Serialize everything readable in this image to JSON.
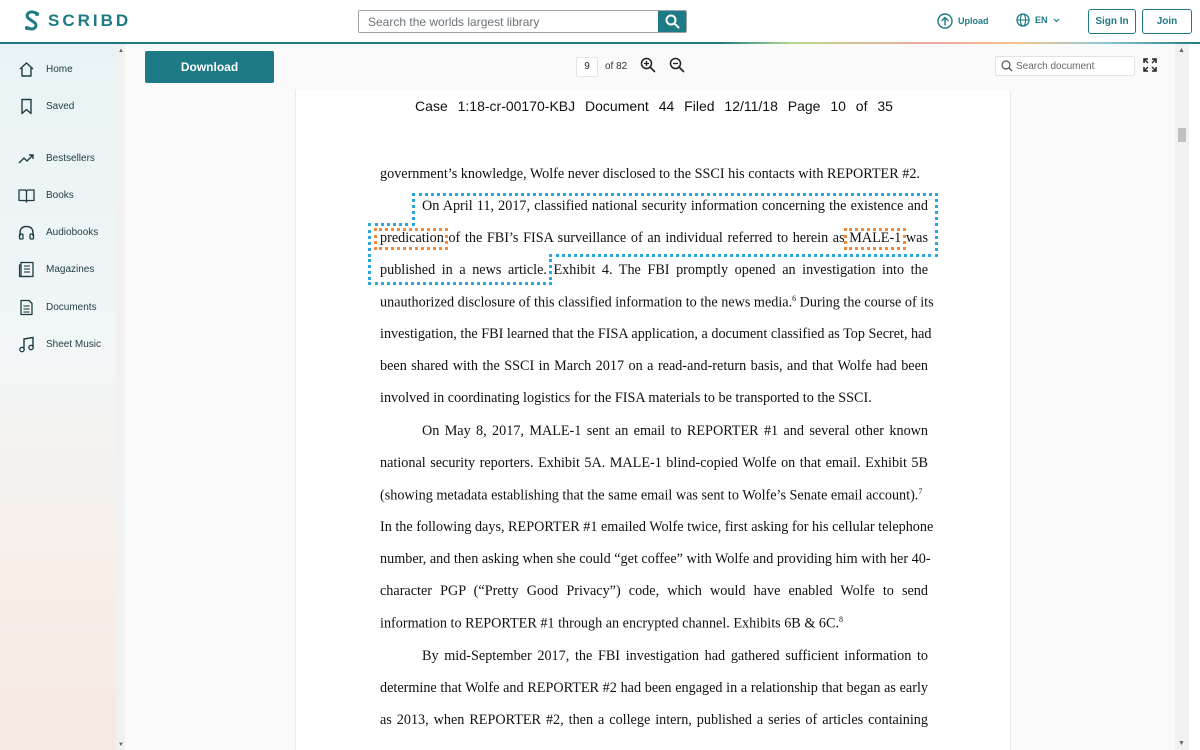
{
  "header": {
    "logo_text": "SCRIBD",
    "search_placeholder": "Search the worlds largest library",
    "upload_label": "Upload",
    "language_label": "EN",
    "signin_label": "Sign In",
    "join_label": "Join",
    "brand_color": "#1e7b85"
  },
  "sidebar": {
    "items": [
      {
        "label": "Home",
        "icon": "home-icon"
      },
      {
        "label": "Saved",
        "icon": "bookmark-icon"
      },
      {
        "label": "Bestsellers",
        "icon": "trending-icon"
      },
      {
        "label": "Books",
        "icon": "book-icon"
      },
      {
        "label": "Audiobooks",
        "icon": "headphones-icon"
      },
      {
        "label": "Magazines",
        "icon": "magazine-icon"
      },
      {
        "label": "Documents",
        "icon": "document-icon"
      },
      {
        "label": "Sheet Music",
        "icon": "music-icon"
      }
    ]
  },
  "toolbar": {
    "download_label": "Download",
    "current_page": "9",
    "page_total": "of 82",
    "doc_search_placeholder": "Search document"
  },
  "document": {
    "header": "Case 1:18-cr-00170-KBJ Document 44 Filed 12/11/18 Page 10 of 35",
    "line1": "government’s knowledge, Wolfe never disclosed to the SSCI his contacts with REPORTER #2.",
    "line2": "On April 11, 2017, classified national security information concerning the existence and",
    "line3_a": "predication",
    "line3_b": " of the FBI’s FISA surveillance of an individual referred to herein as ",
    "line3_c": "MALE-1",
    "line3_d": " was",
    "line4_a": "published in a news article.",
    "line4_b": " Exhibit 4. The FBI promptly opened an investigation into the",
    "line5": "unauthorized disclosure of this classified information to the news media.",
    "fn6": "6",
    "line5_b": " During the course of its",
    "line6": "investigation, the FBI learned that the FISA application, a document classified as Top Secret, had",
    "line7": "been shared with the SSCI in March 2017 on a read-and-return basis, and that Wolfe had been",
    "line8": "involved in coordinating logistics for the FISA materials to be transported to the SSCI.",
    "line9": "On May 8, 2017, MALE-1 sent an email to REPORTER #1 and several other known",
    "line10": "national security reporters. Exhibit 5A. MALE-1 blind-copied Wolfe on that email. Exhibit 5B",
    "line11": "(showing metadata establishing that the same email was sent to Wolfe’s Senate email account).",
    "fn7": "7",
    "line12": "In the following days, REPORTER #1 emailed Wolfe twice, first asking for his cellular telephone",
    "line13": "number, and then asking when she could “get coffee” with Wolfe and providing him with her 40-",
    "line14": "character PGP (“Pretty Good Privacy”) code, which would have enabled Wolfe to send",
    "line15": "information to REPORTER #1 through an encrypted channel. Exhibits 6B & 6C.",
    "fn8": "8",
    "line16": "By mid-September 2017, the FBI investigation had gathered sufficient information to",
    "line17": "determine that Wolfe and REPORTER #2 had been engaged in a relationship that began as early",
    "line18": "as 2013, when REPORTER #2, then a college intern, published a series of articles containing"
  }
}
